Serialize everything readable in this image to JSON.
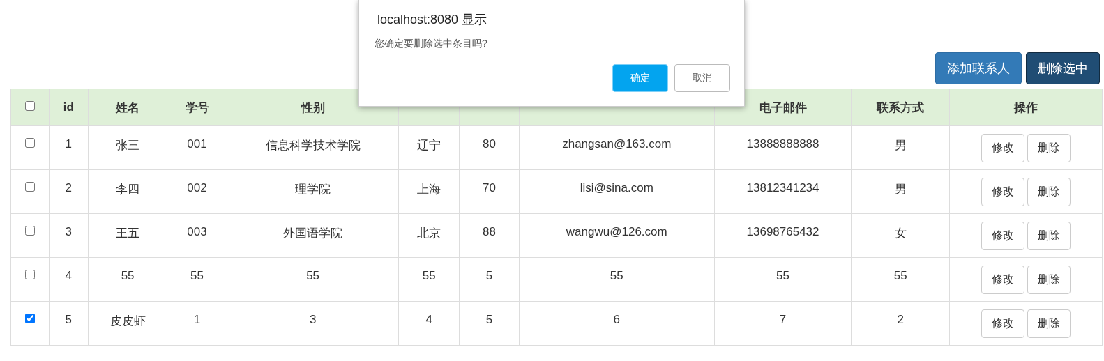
{
  "toolbar": {
    "buttons": [
      {
        "label": "添加联系人",
        "kind": "primary"
      },
      {
        "label": "删除选中",
        "kind": "dark"
      }
    ]
  },
  "table": {
    "select_all": {
      "checked": false
    },
    "columns": [
      "id",
      "姓名",
      "学号",
      "性别",
      null,
      null,
      null,
      "电子邮件",
      "联系方式",
      "操作"
    ],
    "rows": [
      {
        "checked": false,
        "cells": [
          "1",
          "张三",
          "001",
          "信息科学技术学院",
          "辽宁",
          "80",
          "zhangsan@163.com",
          "13888888888",
          "男"
        ],
        "actions": [
          "修改",
          "删除"
        ]
      },
      {
        "checked": false,
        "cells": [
          "2",
          "李四",
          "002",
          "理学院",
          "上海",
          "70",
          "lisi@sina.com",
          "13812341234",
          "男"
        ],
        "actions": [
          "修改",
          "删除"
        ]
      },
      {
        "checked": false,
        "cells": [
          "3",
          "王五",
          "003",
          "外国语学院",
          "北京",
          "88",
          "wangwu@126.com",
          "13698765432",
          "女"
        ],
        "actions": [
          "修改",
          "删除"
        ]
      },
      {
        "checked": false,
        "cells": [
          "4",
          "55",
          "55",
          "55",
          "55",
          "5",
          "55",
          "55",
          "55"
        ],
        "actions": [
          "修改",
          "删除"
        ]
      },
      {
        "checked": true,
        "cells": [
          "5",
          "皮皮虾",
          "1",
          "3",
          "4",
          "5",
          "6",
          "7",
          "2"
        ],
        "actions": [
          "修改",
          "删除"
        ]
      }
    ]
  },
  "dialog": {
    "title": "localhost:8080 显示",
    "message": "您确定要删除选中条目吗?",
    "buttons": [
      {
        "label": "确定",
        "kind": "primary"
      },
      {
        "label": "取消",
        "kind": "secondary"
      }
    ]
  }
}
